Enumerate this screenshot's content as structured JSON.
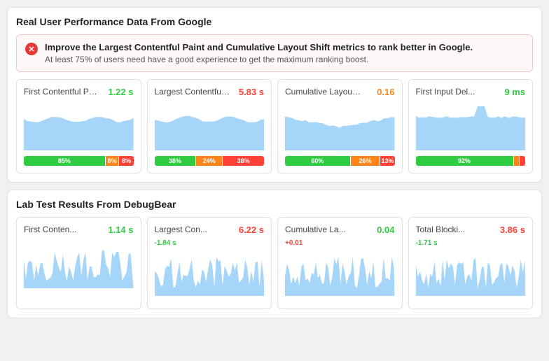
{
  "real_user": {
    "section_title": "Real User Performance Data From Google",
    "alert": {
      "message": "Improve the Largest Contentful Paint and Cumulative Layout Shift metrics to rank better in Google.",
      "sub": "At least 75% of users need have a good experience to get the maximum ranking boost."
    },
    "metrics": [
      {
        "name": "First Contentful Pai...",
        "value": "1.22 s",
        "value_color": "value-green",
        "chart_type": "area_flat",
        "bars": [
          {
            "label": "85%",
            "width": 75,
            "color": "bar-green"
          },
          {
            "label": "8%",
            "width": 12,
            "color": "bar-orange"
          },
          {
            "label": "8%",
            "width": 13,
            "color": "bar-red"
          }
        ]
      },
      {
        "name": "Largest Contentful ...",
        "value": "5.83 s",
        "value_color": "value-red",
        "chart_type": "area_flat",
        "bars": [
          {
            "label": "38%",
            "width": 38,
            "color": "bar-green"
          },
          {
            "label": "24%",
            "width": 24,
            "color": "bar-orange"
          },
          {
            "label": "38%",
            "width": 38,
            "color": "bar-red"
          }
        ]
      },
      {
        "name": "Cumulative Layout S...",
        "value": "0.16",
        "value_color": "value-orange",
        "chart_type": "area_low",
        "bars": [
          {
            "label": "60%",
            "width": 60,
            "color": "bar-green"
          },
          {
            "label": "26%",
            "width": 27,
            "color": "bar-orange"
          },
          {
            "label": "13%",
            "width": 13,
            "color": "bar-red"
          }
        ]
      },
      {
        "name": "First Input Del...",
        "value": "9 ms",
        "value_color": "value-green",
        "chart_type": "area_spike",
        "bars": [
          {
            "label": "92%",
            "width": 90,
            "color": "bar-green"
          },
          {
            "label": "",
            "width": 5,
            "color": "bar-orange"
          },
          {
            "label": "",
            "width": 5,
            "color": "bar-red"
          }
        ]
      }
    ]
  },
  "lab_test": {
    "section_title": "Lab Test Results From DebugBear",
    "metrics": [
      {
        "name": "First Conten...",
        "value": "1.14 s",
        "value_color": "value-green",
        "delta": null,
        "delta_class": ""
      },
      {
        "name": "Largest Con...",
        "value": "6.22 s",
        "value_color": "value-red",
        "delta": "-1.84 s",
        "delta_class": "delta-negative"
      },
      {
        "name": "Cumulative La...",
        "value": "0.04",
        "value_color": "value-green",
        "delta": "+0.01",
        "delta_class": "delta-positive"
      },
      {
        "name": "Total Blocki...",
        "value": "3.86 s",
        "value_color": "value-red",
        "delta": "-1.71 s",
        "delta_class": "delta-negative"
      }
    ]
  }
}
